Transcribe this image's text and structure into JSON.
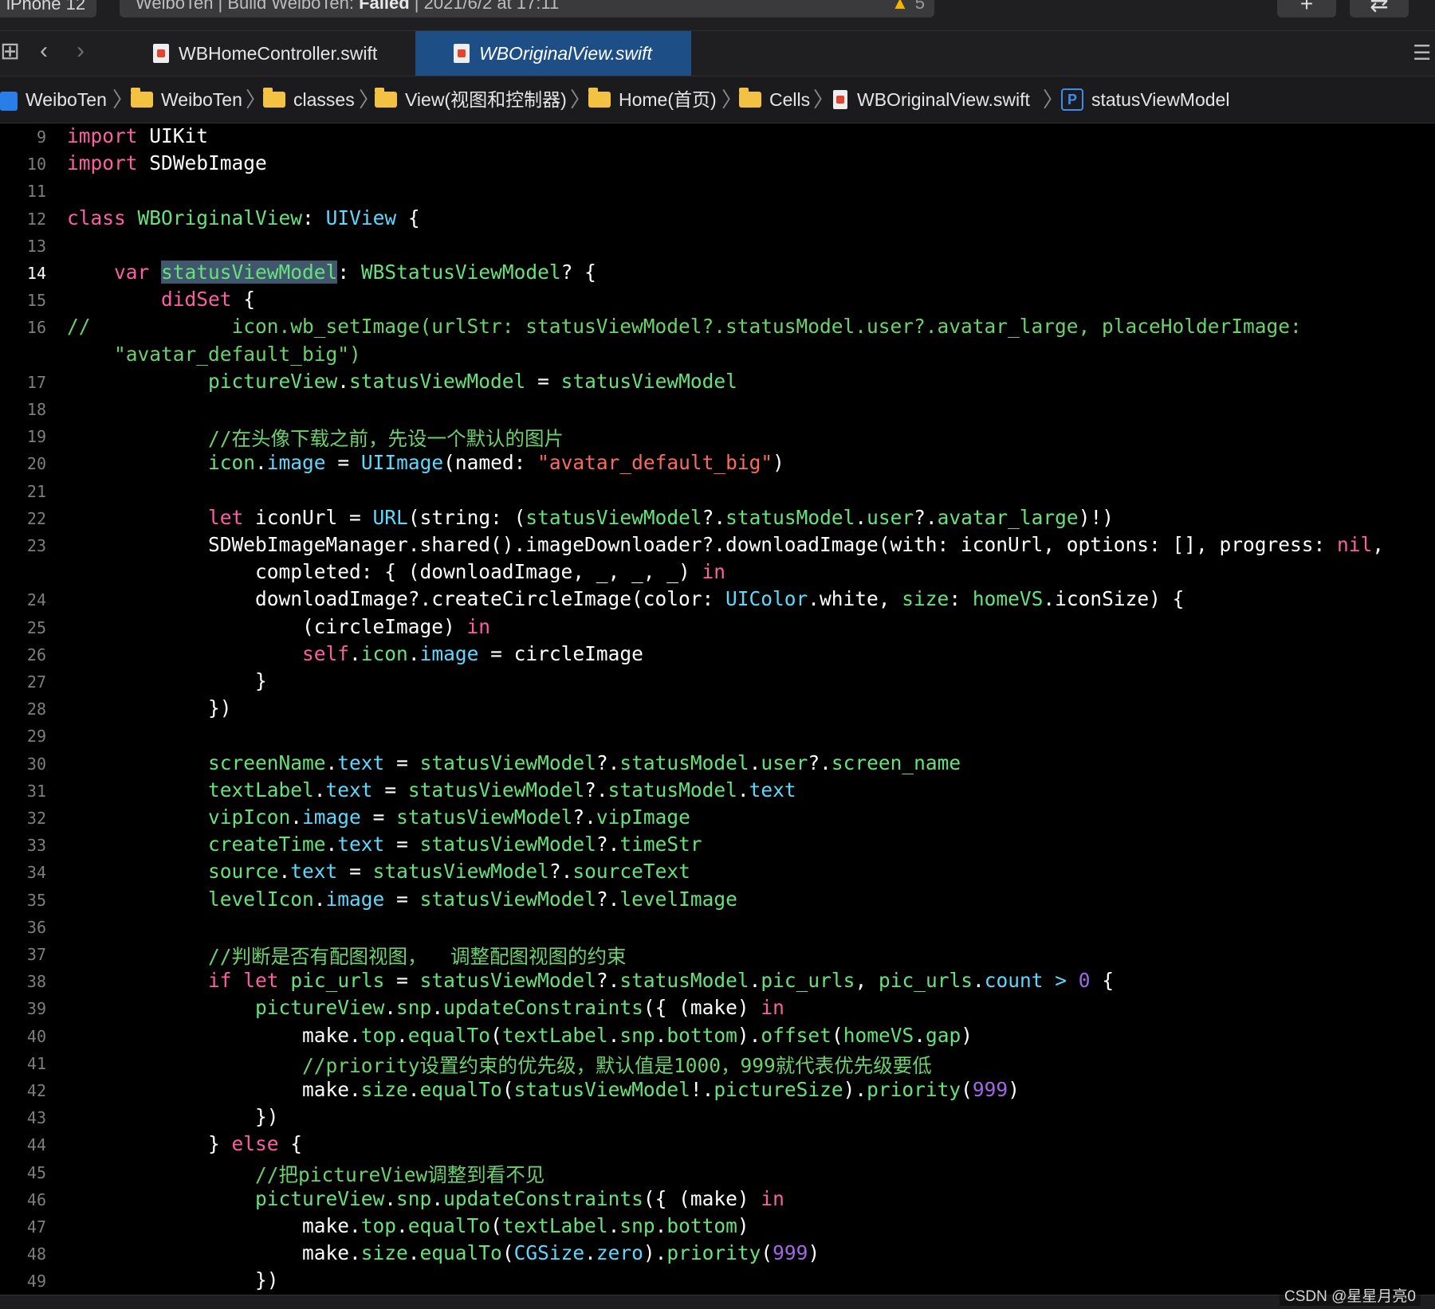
{
  "toolbar": {
    "scheme_device": "iPhone 12",
    "activity_prefix": "WeiboTen | Build WeiboTen: ",
    "activity_status": "Failed",
    "activity_time": " | 2021/6/2 at 17:11",
    "warning_count": "5",
    "add_symbol": "+",
    "swap_symbol": "⇄"
  },
  "tabs": [
    {
      "label": "WBHomeController.swift",
      "active": false
    },
    {
      "label": "WBOriginalView.swift",
      "active": true
    }
  ],
  "breadcrumb": [
    "WeiboTen",
    "WeiboTen",
    "classes",
    "View(视图和控制器)",
    "Home(首页)",
    "Cells",
    "WBOriginalView.swift",
    "statusViewModel"
  ],
  "breadcrumb_symbol_badge": "P",
  "current_line": "14",
  "colors": {
    "keyword": "#fc5fa3",
    "type": "#5dd8ff",
    "identifier": "#67e27a",
    "comment": "#6bd26b",
    "string": "#fc6a5d",
    "number": "#a167e6",
    "active_tab": "#1e4e86"
  },
  "code_lines": [
    {
      "num": "9",
      "text": "import UIKit"
    },
    {
      "num": "10",
      "text": "import SDWebImage"
    },
    {
      "num": "11",
      "text": ""
    },
    {
      "num": "12",
      "text": "class WBOriginalView: UIView {"
    },
    {
      "num": "13",
      "text": ""
    },
    {
      "num": "14",
      "text": "    var statusViewModel: WBStatusViewModel? {"
    },
    {
      "num": "15",
      "text": "        didSet {"
    },
    {
      "num": "16",
      "text": "//            icon.wb_setImage(urlStr: statusViewModel?.statusModel.user?.avatar_large, placeHolderImage:"
    },
    {
      "num": "",
      "text": "    \"avatar_default_big\")"
    },
    {
      "num": "17",
      "text": "            pictureView.statusViewModel = statusViewModel"
    },
    {
      "num": "18",
      "text": ""
    },
    {
      "num": "19",
      "text": "            //在头像下载之前，先设一个默认的图片"
    },
    {
      "num": "20",
      "text": "            icon.image = UIImage(named: \"avatar_default_big\")"
    },
    {
      "num": "21",
      "text": ""
    },
    {
      "num": "22",
      "text": "            let iconUrl = URL(string: (statusViewModel?.statusModel.user?.avatar_large)!)"
    },
    {
      "num": "23",
      "text": "            SDWebImageManager.shared().imageDownloader?.downloadImage(with: iconUrl, options: [], progress: nil,"
    },
    {
      "num": "",
      "text": "                completed: { (downloadImage, _, _, _) in"
    },
    {
      "num": "24",
      "text": "                downloadImage?.createCircleImage(color: UIColor.white, size: homeVS.iconSize) {"
    },
    {
      "num": "25",
      "text": "                    (circleImage) in"
    },
    {
      "num": "26",
      "text": "                    self.icon.image = circleImage"
    },
    {
      "num": "27",
      "text": "                }"
    },
    {
      "num": "28",
      "text": "            })"
    },
    {
      "num": "29",
      "text": ""
    },
    {
      "num": "30",
      "text": "            screenName.text = statusViewModel?.statusModel.user?.screen_name"
    },
    {
      "num": "31",
      "text": "            textLabel.text = statusViewModel?.statusModel.text"
    },
    {
      "num": "32",
      "text": "            vipIcon.image = statusViewModel?.vipImage"
    },
    {
      "num": "33",
      "text": "            createTime.text = statusViewModel?.timeStr"
    },
    {
      "num": "34",
      "text": "            source.text = statusViewModel?.sourceText"
    },
    {
      "num": "35",
      "text": "            levelIcon.image = statusViewModel?.levelImage"
    },
    {
      "num": "36",
      "text": ""
    },
    {
      "num": "37",
      "text": "            //判断是否有配图视图，  调整配图视图的约束"
    },
    {
      "num": "38",
      "text": "            if let pic_urls = statusViewModel?.statusModel.pic_urls, pic_urls.count > 0 {"
    },
    {
      "num": "39",
      "text": "                pictureView.snp.updateConstraints({ (make) in"
    },
    {
      "num": "40",
      "text": "                    make.top.equalTo(textLabel.snp.bottom).offset(homeVS.gap)"
    },
    {
      "num": "41",
      "text": "                    //priority设置约束的优先级，默认值是1000，999就代表优先级要低"
    },
    {
      "num": "42",
      "text": "                    make.size.equalTo(statusViewModel!.pictureSize).priority(999)"
    },
    {
      "num": "43",
      "text": "                })"
    },
    {
      "num": "44",
      "text": "            } else {"
    },
    {
      "num": "45",
      "text": "                //把pictureView调整到看不见"
    },
    {
      "num": "46",
      "text": "                pictureView.snp.updateConstraints({ (make) in"
    },
    {
      "num": "47",
      "text": "                    make.top.equalTo(textLabel.snp.bottom)"
    },
    {
      "num": "48",
      "text": "                    make.size.equalTo(CGSize.zero).priority(999)"
    },
    {
      "num": "49",
      "text": "                })"
    }
  ],
  "watermark": "CSDN @星星月亮0"
}
